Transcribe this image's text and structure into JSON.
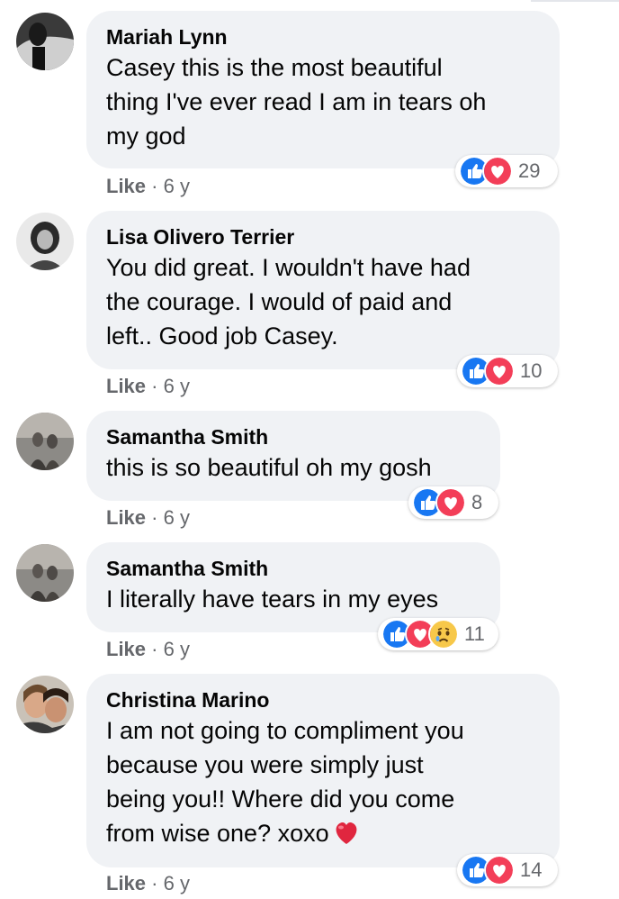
{
  "comments": [
    {
      "author": "Mariah Lynn",
      "lines": [
        "Casey this is the most beautiful",
        "thing I've ever read I am in tears oh",
        "my god"
      ],
      "like_label": "Like",
      "time": "6 y",
      "reaction_count": "29",
      "reactions": [
        "like-icon",
        "love-icon"
      ]
    },
    {
      "author": "Lisa Olivero Terrier",
      "lines": [
        "You did great. I wouldn't have had",
        "the courage. I would of paid and",
        "left.. Good job Casey."
      ],
      "like_label": "Like",
      "time": "6 y",
      "reaction_count": "10",
      "reactions": [
        "like-icon",
        "love-icon"
      ]
    },
    {
      "author": "Samantha Smith",
      "lines": [
        "this is so beautiful oh my gosh"
      ],
      "like_label": "Like",
      "time": "6 y",
      "reaction_count": "8",
      "reactions": [
        "like-icon",
        "love-icon"
      ]
    },
    {
      "author": "Samantha Smith",
      "lines": [
        "I literally have tears in my eyes"
      ],
      "like_label": "Like",
      "time": "6 y",
      "reaction_count": "11",
      "reactions": [
        "like-icon",
        "love-icon",
        "sad-icon"
      ]
    },
    {
      "author": "Christina Marino",
      "lines": [
        "I am not going to compliment you",
        "because you were simply just",
        "being you!! Where did you come",
        "from wise one? xoxo"
      ],
      "like_label": "Like",
      "time": "6 y",
      "reaction_count": "14",
      "reactions": [
        "like-icon",
        "love-icon"
      ]
    }
  ],
  "separator": "·",
  "colors": {
    "bubble": "#f0f2f5",
    "like_blue": "#1877f2",
    "love_red": "#f33e58",
    "meta_gray": "#65676b"
  }
}
